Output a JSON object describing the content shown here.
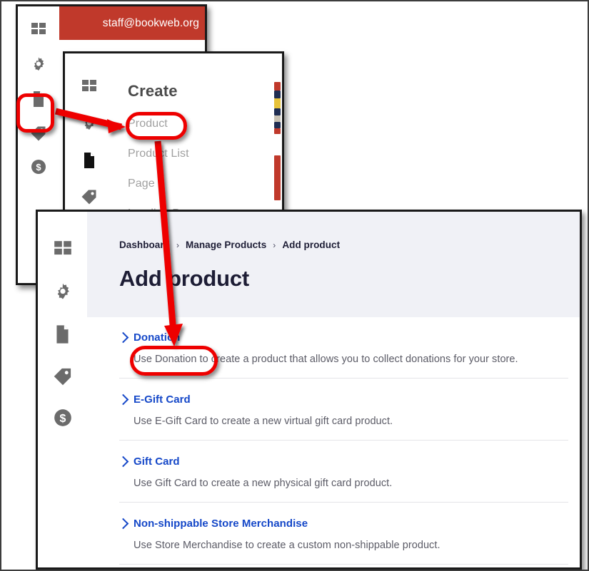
{
  "window_back": {
    "name": "bookweb-admin-window",
    "account_email": "staff@bookweb.org",
    "accent_color": "#c0392b",
    "sidebar": {
      "items": [
        {
          "icon": "dashboard-grid-icon",
          "label": "Dashboard",
          "active": false
        },
        {
          "icon": "gear-icon",
          "label": "Settings",
          "active": false
        },
        {
          "icon": "page-document-icon",
          "label": "Content",
          "active": true
        },
        {
          "icon": "tag-icon",
          "label": "Marketing",
          "active": false
        },
        {
          "icon": "dollar-circle-icon",
          "label": "Finance",
          "active": false
        }
      ]
    }
  },
  "window_create": {
    "name": "create-menu-window",
    "menu_title": "Create",
    "items": [
      {
        "label": "Product",
        "highlighted": true
      },
      {
        "label": "Product List",
        "highlighted": false
      },
      {
        "label": "Page",
        "highlighted": false
      },
      {
        "label": "Landing Page",
        "highlighted": false
      }
    ],
    "sidebar": {
      "items": [
        {
          "icon": "dashboard-grid-icon",
          "label": "Dashboard",
          "active": false
        },
        {
          "icon": "gear-icon",
          "label": "Settings",
          "active": false
        },
        {
          "icon": "page-document-icon",
          "label": "Content",
          "active": true
        },
        {
          "icon": "tag-icon",
          "label": "Marketing",
          "active": false
        }
      ]
    }
  },
  "window_front": {
    "name": "add-product-window",
    "breadcrumb": {
      "items": [
        "Dashboard",
        "Manage Products",
        "Add product"
      ],
      "separator": "›"
    },
    "page_title": "Add product",
    "header_bg": "#f0f1f6",
    "sidebar": {
      "items": [
        {
          "icon": "dashboard-grid-icon",
          "label": "Dashboard",
          "active": false
        },
        {
          "icon": "gear-icon",
          "label": "Settings",
          "active": false
        },
        {
          "icon": "page-document-icon",
          "label": "Content",
          "active": false
        },
        {
          "icon": "tag-icon",
          "label": "Marketing",
          "active": false
        },
        {
          "icon": "dollar-circle-icon",
          "label": "Finance",
          "active": false
        }
      ]
    },
    "product_types": [
      {
        "label": "Donation",
        "description": "Use Donation to create a product that allows you to collect donations for your store.",
        "highlighted": true
      },
      {
        "label": "E-Gift Card",
        "description": "Use E-Gift Card to create a new virtual gift card product.",
        "highlighted": false
      },
      {
        "label": "Gift Card",
        "description": "Use Gift Card to create a new physical gift card product.",
        "highlighted": false
      },
      {
        "label": "Non-shippable Store Merchandise",
        "description": "Use Store Merchandise to create a custom non-shippable product.",
        "highlighted": false
      }
    ],
    "link_color": "#1447c8"
  },
  "annotations": {
    "highlight_color": "#ee0000",
    "arrows": [
      {
        "name": "arrow-sidebar-to-product",
        "from": "sidebar-content-icon",
        "to": "create-menu-product-item"
      },
      {
        "name": "arrow-product-to-donation",
        "from": "create-menu-product-item",
        "to": "product-type-donation"
      }
    ]
  }
}
